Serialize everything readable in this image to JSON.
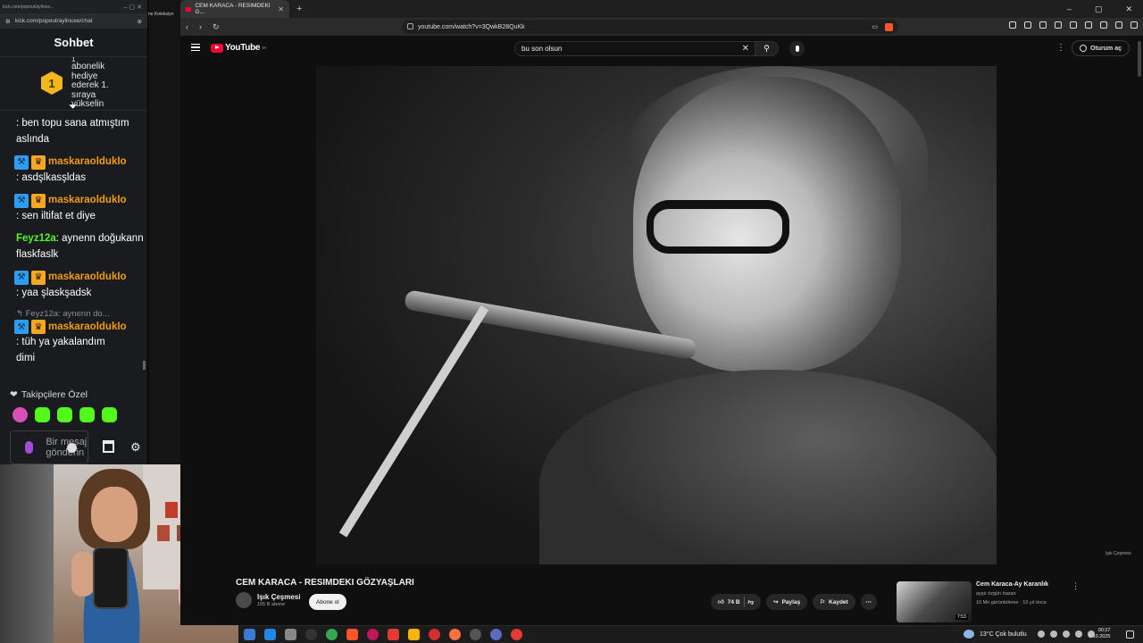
{
  "kick": {
    "tab_url": "kick.com/popout/aylince...",
    "url": "kick.com/popout/aylincee/chat",
    "chat_title": "Sohbet",
    "gift_rank": "1",
    "gift_text": "abonelik hediye ederek 1. sıraya yükselin",
    "gift_prefix": "1",
    "messages": [
      {
        "user": "",
        "text": ": ben topu sana atmıştım aslında"
      },
      {
        "user": "maskaraoldukIo",
        "text": ": asdşlkasşldas"
      },
      {
        "user": "maskaraoldukIo",
        "text": ": sen iltifat et diye"
      },
      {
        "user": "Feyz12a",
        "text": ": aynenn doğukann flaskfaslk"
      },
      {
        "user": "maskaraoldukIo",
        "text": ": yaa şlaskşadsk"
      },
      {
        "user": "maskaraoldukIo",
        "text": ": tüh ya yakalandım dimi",
        "reply": "Feyz12a: aynenn do..."
      }
    ],
    "followers_label": "Takipçilere Özel",
    "input_placeholder": "Bir mesaj gönderin",
    "colors": {
      "username": "#f39c12",
      "green": "#53fc18"
    }
  },
  "strip_label": "ne Koleksiyo",
  "browser": {
    "tab_title": "CEM KARACA - RESIMDEKI G...",
    "url": "youtube.com/watch?v=3QwkB28QuKk",
    "search_query": "bu son olsun",
    "sign_in": "Oturum aç",
    "logo_text": "YouTube",
    "logo_region": "TR"
  },
  "video": {
    "title": "CEM KARACA - RESIMDEKI GÖZYAŞLARI",
    "channel": "Işık Çeşmesi",
    "subscribers": "105 B abone",
    "subscribe_label": "Abone ol",
    "likes": "74 B",
    "share_label": "Paylaş",
    "save_label": "Kaydet",
    "watermark": "Işık Çeşmesi"
  },
  "recommendation": {
    "title": "Cem Karaca-Ay Karanlık",
    "channel": "ayşe özgün hazan",
    "views": "10 Mn görüntüleme · 10 yıl önce",
    "duration": "7:53"
  },
  "taskbar": {
    "weather": "13°C  Çok bulutlu",
    "time": "00:27",
    "date": "6.10.2025"
  }
}
